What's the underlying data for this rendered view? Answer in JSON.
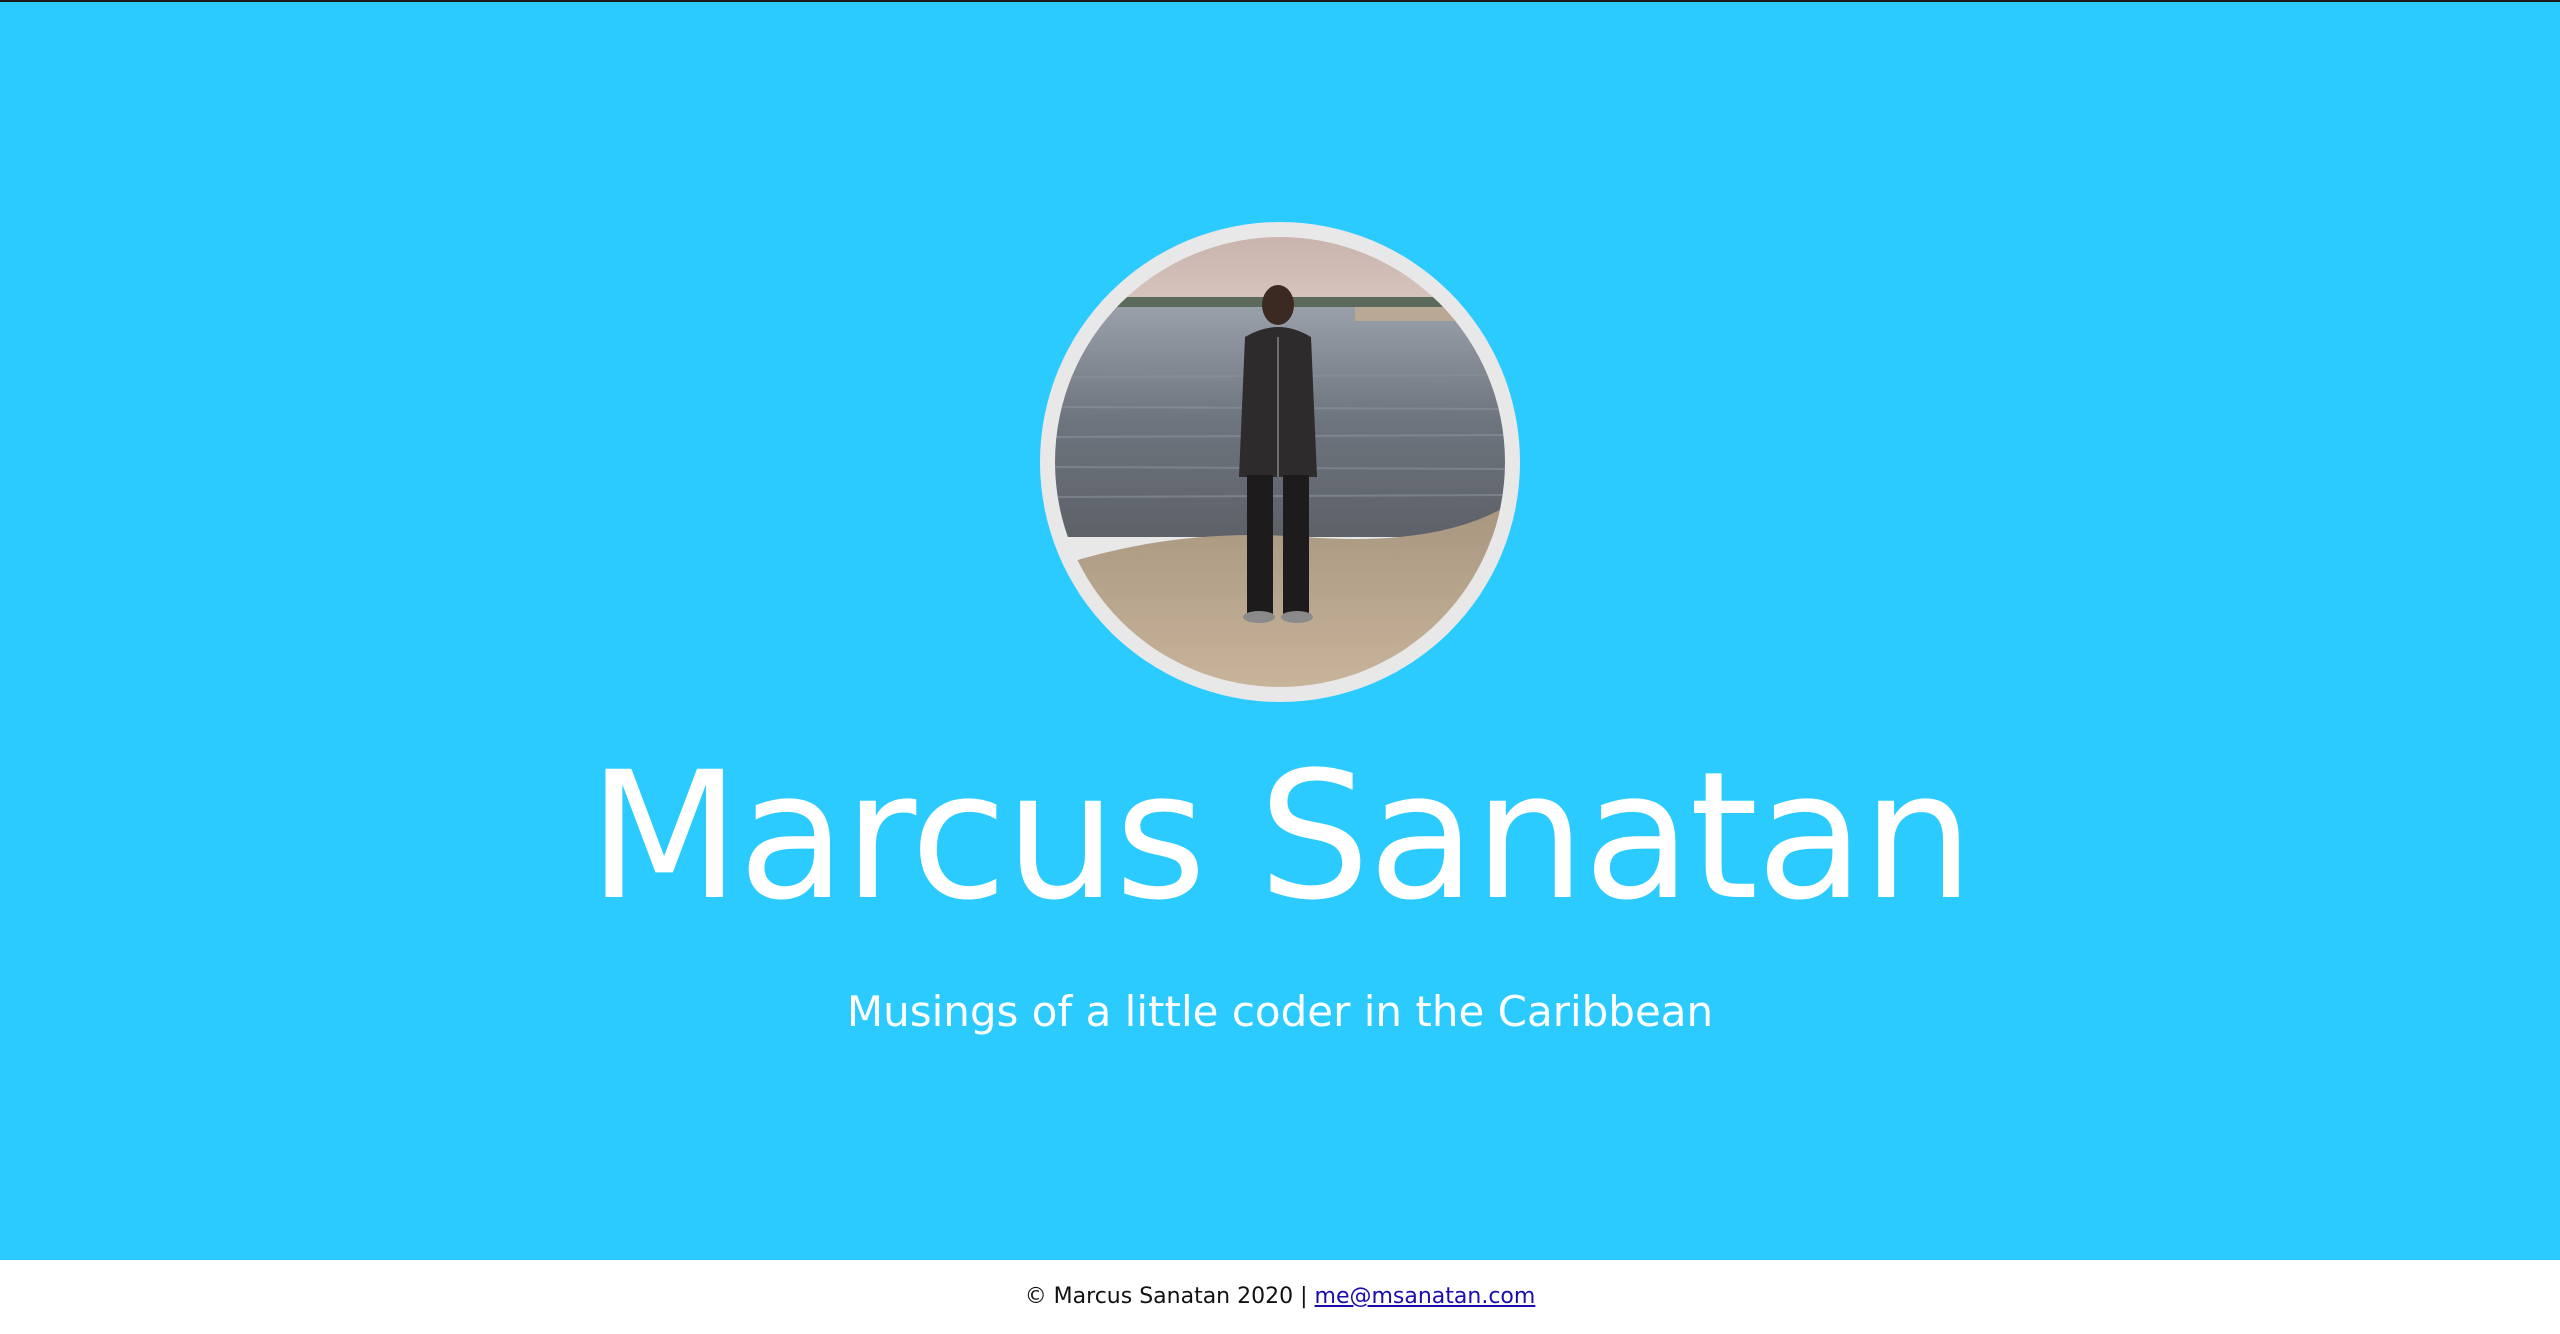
{
  "hero": {
    "background_color": "#2bcbff",
    "avatar_alt": "profile photo of a man standing on a beach",
    "name": "Marcus Sanatan",
    "tagline": "Musings of a little coder in the Caribbean"
  },
  "footer": {
    "copyright": "© Marcus Sanatan 2020 |",
    "email": "me@msanatan.com",
    "email_link_color": "#1a0dab"
  }
}
